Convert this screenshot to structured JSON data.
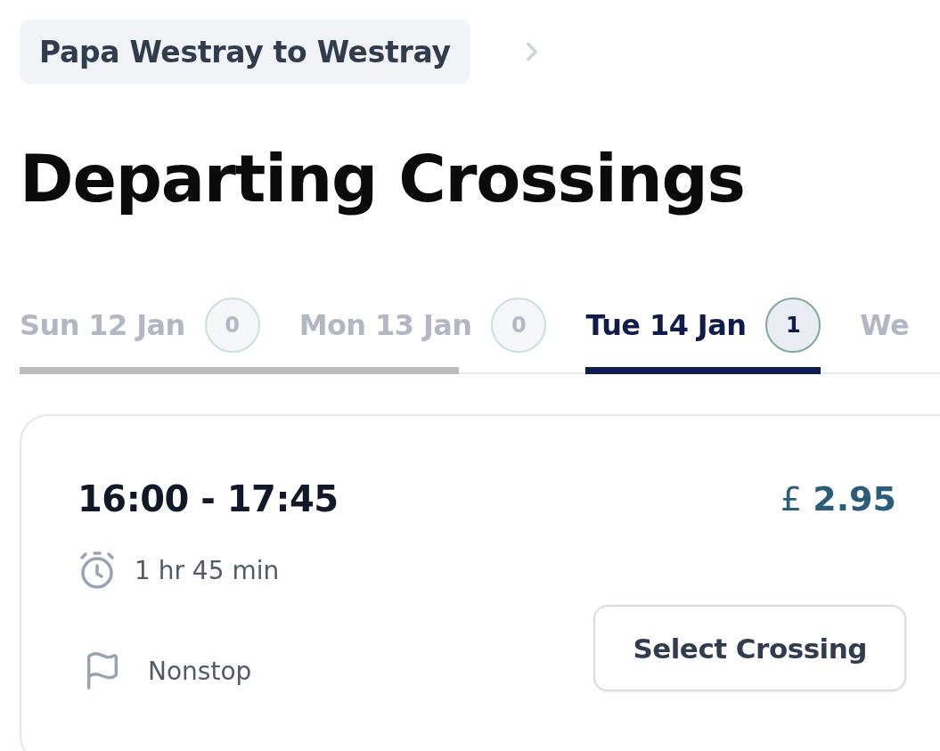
{
  "breadcrumb": {
    "label": "Papa Westray to Westray"
  },
  "heading": "Departing Crossings",
  "date_tabs": [
    {
      "label": "Sun 12 Jan",
      "count": "0",
      "selected": false
    },
    {
      "label": "Mon 13 Jan",
      "count": "0",
      "selected": false
    },
    {
      "label": "Tue 14 Jan",
      "count": "1",
      "selected": true
    },
    {
      "label": "We",
      "selected": false
    }
  ],
  "crossings": [
    {
      "time": "16:00 - 17:45",
      "price": "£ **2.95**",
      "duration": "1 hr 45 min",
      "stops": "Nonstop",
      "button": "Select Crossing"
    }
  ]
}
